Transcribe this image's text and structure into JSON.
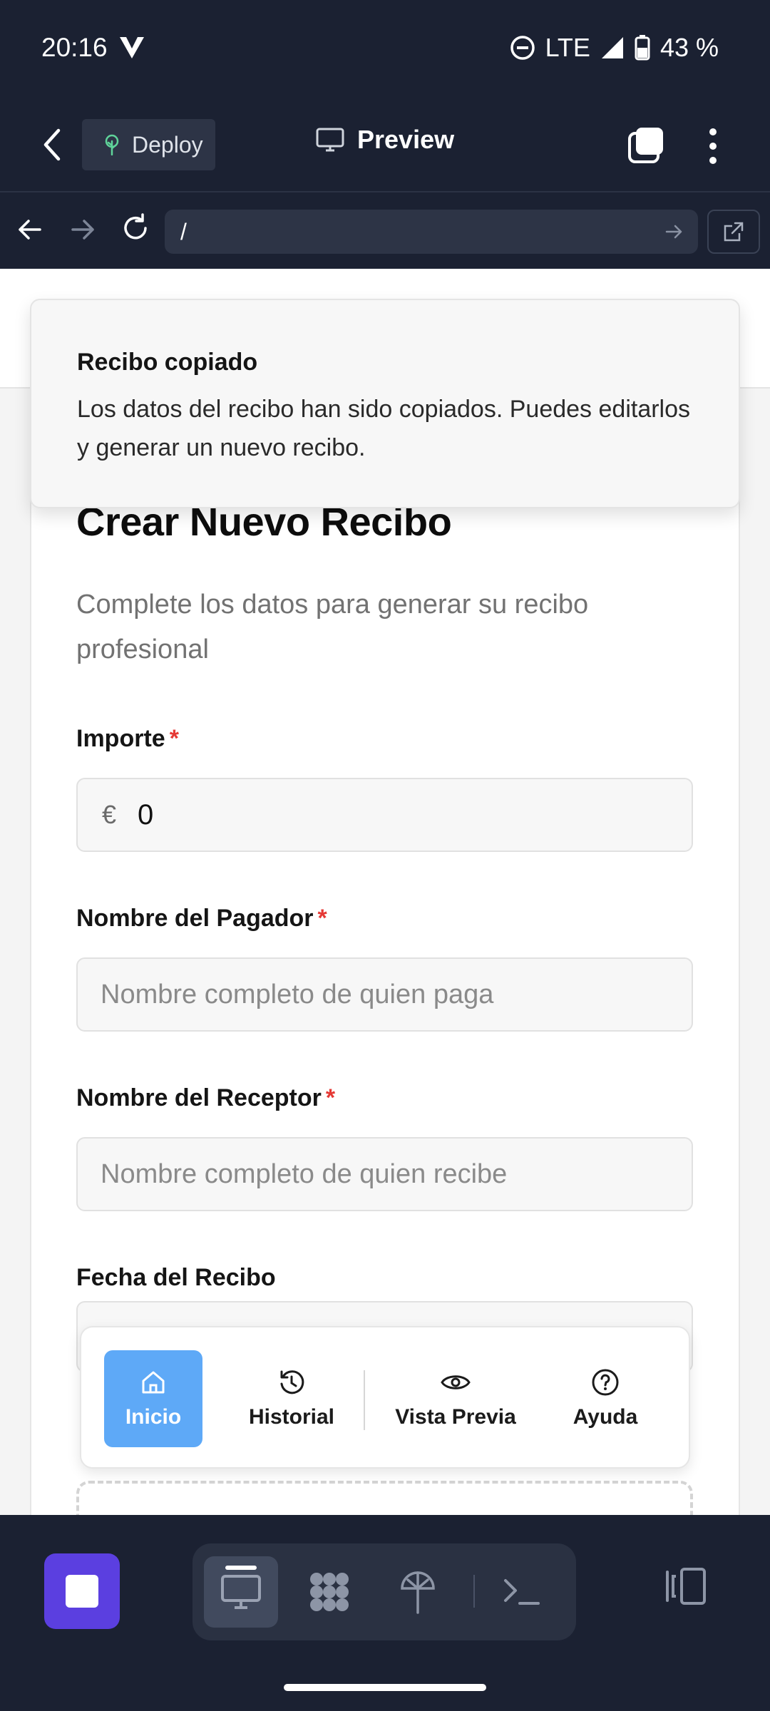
{
  "status_bar": {
    "time": "20:16",
    "network": "LTE",
    "battery": "43 %"
  },
  "app_bar": {
    "deploy_label": "Deploy",
    "title": "Preview"
  },
  "url_bar": {
    "url": "/"
  },
  "toast": {
    "title": "Recibo copiado",
    "body": "Los datos del recibo han sido copiados. Puedes editarlos y generar un nuevo recibo."
  },
  "form": {
    "title": "Crear Nuevo Recibo",
    "subtitle": "Complete los datos para generar su recibo profesional",
    "amount": {
      "label": "Importe",
      "required_mark": "*",
      "currency": "€",
      "value": "0"
    },
    "payer": {
      "label": "Nombre del Pagador",
      "required_mark": "*",
      "placeholder": "Nombre completo de quien paga"
    },
    "receiver": {
      "label": "Nombre del Receptor",
      "required_mark": "*",
      "placeholder": "Nombre completo de quien recibe"
    },
    "date": {
      "label": "Fecha del Recibo"
    }
  },
  "bottom_nav": {
    "items": [
      {
        "label": "Inicio",
        "icon": "home-icon",
        "active": true
      },
      {
        "label": "Historial",
        "icon": "history-icon",
        "active": false
      },
      {
        "label": "Vista Previa",
        "icon": "eye-icon",
        "active": false
      },
      {
        "label": "Ayuda",
        "icon": "help-icon",
        "active": false
      }
    ]
  },
  "toolbar": {
    "tools": [
      "desktop-icon",
      "grid-icon",
      "deploy-icon",
      "terminal-icon"
    ]
  },
  "colors": {
    "chrome_bg": "#1b2132",
    "accent_active": "#5ea9f7",
    "stop_button": "#5b3fe0",
    "required": "#e53935"
  }
}
